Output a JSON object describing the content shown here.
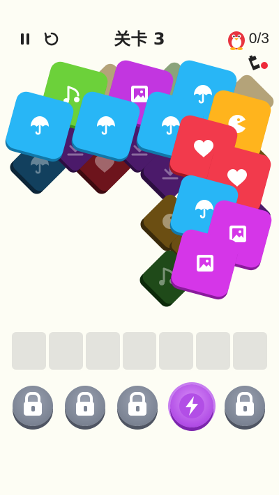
{
  "header": {
    "title": "关卡 3",
    "goal_count": "0/3",
    "pause_icon": "pause-icon",
    "restart_icon": "restart-icon",
    "goal_icon": "penguin-icon",
    "shuffle_icon": "magnet-icon"
  },
  "slots": {
    "count": 7
  },
  "powerups": [
    {
      "name": "powerup-1",
      "state": "locked",
      "icon": "lock-icon"
    },
    {
      "name": "powerup-2",
      "state": "locked",
      "icon": "lock-icon"
    },
    {
      "name": "powerup-3",
      "state": "locked",
      "icon": "lock-icon"
    },
    {
      "name": "powerup-4",
      "state": "available",
      "icon": "lightning-icon"
    },
    {
      "name": "powerup-5",
      "state": "locked",
      "icon": "lock-icon"
    }
  ],
  "tile_colors": {
    "green": "#6cd13a",
    "purple": "#c236e0",
    "cyan": "#28b6f6",
    "yellow": "#ffb41d",
    "red": "#f23a4c",
    "magenta": "#d536e8"
  }
}
